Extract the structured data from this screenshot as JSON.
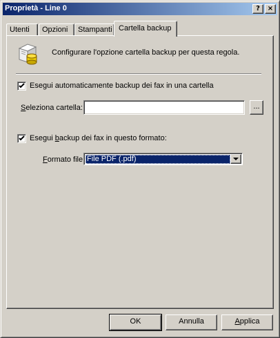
{
  "window": {
    "title": "Proprietà - Line 0",
    "help_glyph": "?",
    "close_glyph": "×"
  },
  "tabs": [
    {
      "label": "Utenti",
      "active": false
    },
    {
      "label": "Opzioni",
      "active": false
    },
    {
      "label": "Stampanti",
      "active": false
    },
    {
      "label": "Cartella backup",
      "active": true
    }
  ],
  "header": {
    "icon": "backup-folder-icon",
    "text": "Configurare l'opzione cartella backup per questa regola."
  },
  "backup_folder": {
    "checked": true,
    "checkbox_label": "Esegui automaticamente backup dei fax in una cartella",
    "field_label_prefix": "",
    "field_label_accel": "S",
    "field_label_rest": "eleziona cartella:",
    "value": "",
    "browse_label": "..."
  },
  "backup_format": {
    "checked": true,
    "checkbox_label_prefix": "Esegui ",
    "checkbox_label_accel": "b",
    "checkbox_label_rest": "ackup dei fax in questo formato:",
    "field_label_prefix": "",
    "field_label_accel": "F",
    "field_label_rest": "ormato file:",
    "selected": "File PDF (.pdf)"
  },
  "buttons": {
    "ok": "OK",
    "cancel": "Annulla",
    "apply_accel": "A",
    "apply_rest": "pplica"
  },
  "colors": {
    "titlebar_start": "#0a246a",
    "titlebar_end": "#a6caf0",
    "face": "#d4d0c8",
    "selection": "#0a246a"
  }
}
